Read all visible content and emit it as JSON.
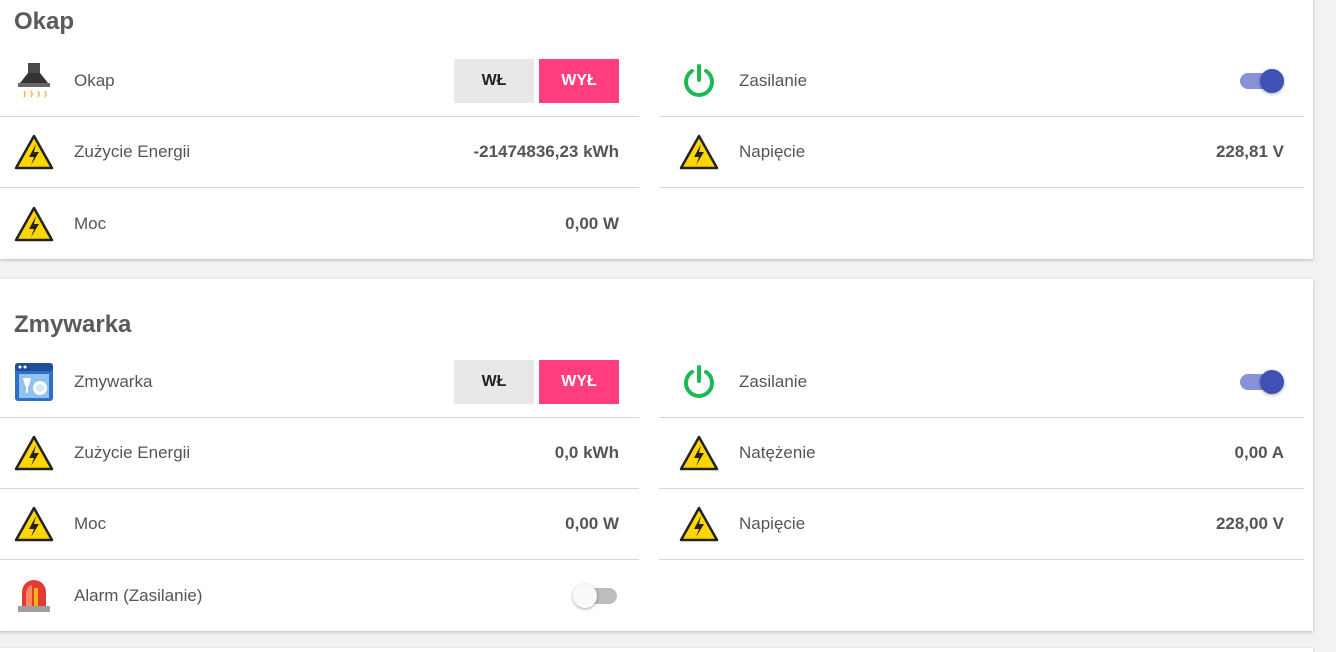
{
  "sections": [
    {
      "title": "Okap",
      "device": {
        "label": "Okap",
        "on_label": "WŁ",
        "off_label": "WYŁ"
      },
      "rows": {
        "energy": {
          "label": "Zużycie Energii",
          "value": "-21474836,23 kWh"
        },
        "power": {
          "label": "Moc",
          "value": "0,00 W"
        },
        "supply": {
          "label": "Zasilanie",
          "state": "on"
        },
        "voltage": {
          "label": "Napięcie",
          "value": "228,81 V"
        }
      }
    },
    {
      "title": "Zmywarka",
      "device": {
        "label": "Zmywarka",
        "on_label": "WŁ",
        "off_label": "WYŁ"
      },
      "rows": {
        "energy": {
          "label": "Zużycie Energii",
          "value": "0,0 kWh"
        },
        "power": {
          "label": "Moc",
          "value": "0,00 W"
        },
        "alarm": {
          "label": "Alarm (Zasilanie)",
          "state": "off"
        },
        "supply": {
          "label": "Zasilanie",
          "state": "on"
        },
        "current": {
          "label": "Natężenie",
          "value": "0,00 A"
        },
        "voltage": {
          "label": "Napięcie",
          "value": "228,00 V"
        }
      }
    }
  ],
  "icons": {
    "warning": "warning-triangle-icon",
    "power": "power-icon",
    "hood": "range-hood-icon",
    "dishwasher": "dishwasher-icon",
    "alarm": "siren-icon"
  },
  "colors": {
    "accent": "#ff3d7f",
    "toggle_on": "#3f51b5",
    "power_icon": "#1db954",
    "warning": "#ffd600"
  }
}
